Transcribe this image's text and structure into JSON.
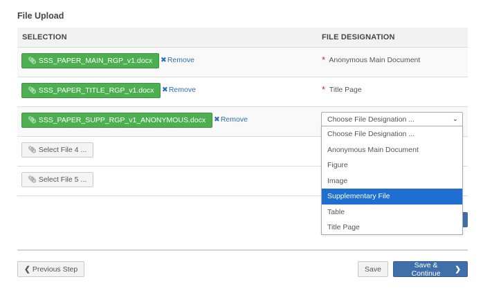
{
  "page": {
    "title": "File Upload"
  },
  "table": {
    "headers": {
      "selection": "SELECTION",
      "designation": "FILE DESIGNATION"
    },
    "rows": [
      {
        "file": "SSS_PAPER_MAIN_RGP_v1.docx",
        "remove": "Remove",
        "designation": "Anonymous Main Document",
        "required": "*"
      },
      {
        "file": "SSS_PAPER_TITLE_RGP_v1.docx",
        "remove": "Remove",
        "designation": "Title Page",
        "required": "*"
      },
      {
        "file": "SSS_PAPER_SUPP_RGP_v1_ANONYMOUS.docx",
        "remove": "Remove",
        "select_value": "Choose File Designation ..."
      },
      {
        "select_label": "Select File 4 ..."
      },
      {
        "select_label": "Select File 5 ..."
      }
    ]
  },
  "dropdown": {
    "options": [
      "Choose File Designation ...",
      "Anonymous Main Document",
      "Figure",
      "Image",
      "Supplementary File",
      "Table",
      "Title Page"
    ],
    "highlighted": "Supplementary File"
  },
  "footer": {
    "previous_label": "Previous Step",
    "save_label": "Save",
    "continue_label": "Save & Continue"
  },
  "icons": {
    "attach": "paperclip-icon",
    "remove": "close-icon",
    "chevron": "chevron-down-icon"
  },
  "colors": {
    "file_button": "#4caf50",
    "link": "#2a6fb0",
    "primary": "#3f6fa8",
    "highlight": "#1e6fd1",
    "required": "#d9232d"
  }
}
